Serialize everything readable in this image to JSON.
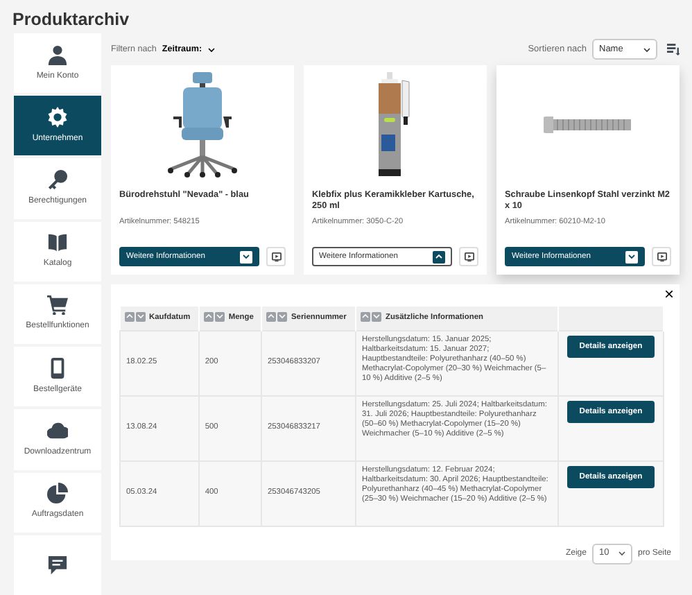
{
  "page_title": "Produktarchiv",
  "sidebar": {
    "items": [
      {
        "label": "Mein Konto",
        "selected": false
      },
      {
        "label": "Unternehmen",
        "selected": true
      },
      {
        "label": "Berechtigungen",
        "selected": false
      },
      {
        "label": "Katalog",
        "selected": false
      },
      {
        "label": "Bestellfunktionen",
        "selected": false
      },
      {
        "label": "Bestellgeräte",
        "selected": false
      },
      {
        "label": "Downloadzentrum",
        "selected": false
      },
      {
        "label": "Auftragsdaten",
        "selected": false
      },
      {
        "selected": false
      }
    ]
  },
  "filter": {
    "label": "Filtern nach",
    "value": "Zeitraum:"
  },
  "sort": {
    "label": "Sortieren nach",
    "value": "Name"
  },
  "products": [
    {
      "name": "Bürodrehstuhl \"Nevada\" - blau",
      "article": "Artikelnummer: 548215",
      "button": "Weitere Informationen",
      "expanded": false,
      "hovered": false
    },
    {
      "name": "Klebfix plus Keramikkleber Kartusche, 250 ml",
      "article": "Artikelnummer: 3050-C-20",
      "button": "Weitere Informationen",
      "expanded": true,
      "hovered": false
    },
    {
      "name": "Schraube Linsenkopf Stahl verzinkt M2 x 10",
      "article": "Artikelnummer: 60210-M2-10",
      "button": "Weitere Informationen",
      "expanded": false,
      "hovered": true
    }
  ],
  "details": {
    "close": "×",
    "columns": [
      "Kaufdatum",
      "Menge",
      "Seriennummer",
      "Zusätzliche Informationen"
    ],
    "rows": [
      {
        "date": "18.02.25",
        "quantity": "200",
        "serial": "253046833207",
        "info": "Herstellungsdatum: 15. Januar 2025; Haltbarkeitsdatum: 15. Januar 2027; Hauptbestandteile: Polyurethanharz (40–50 %) Methacrylat-Copolymer (20–30 %) Weichmacher (5–10 %) Additive (2–5 %)",
        "button": "Details anzeigen"
      },
      {
        "date": "13.08.24",
        "quantity": "500",
        "serial": "253046833217",
        "info": "Herstellungsdatum: 25. Juli 2024; Haltbarkeitsdatum: 31. Juli 2026; Hauptbestandteile: Polyurethanharz (50–60 %) Methacrylat-Copolymer (15–20 %) Weichmacher (5–10 %) Additive (2–5 %)",
        "button": "Details anzeigen"
      },
      {
        "date": "05.03.24",
        "quantity": "400",
        "serial": "253046743205",
        "info": "Herstellungsdatum: 12. Februar 2024; Haltbarkeitsdatum: 30. April 2026; Hauptbestandteile: Polyurethanharz (40–45 %) Methacrylat-Copolymer (25–30 %) Weichmacher (15–20 %) Additive (2–5 %)",
        "button": "Details anzeigen"
      }
    ],
    "pagination": {
      "before": "Zeige",
      "value": "10",
      "after": "pro Seite"
    }
  }
}
